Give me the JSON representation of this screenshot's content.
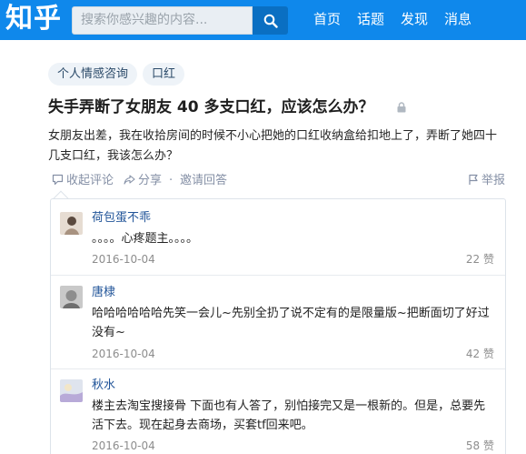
{
  "header": {
    "logo": "知乎",
    "search_placeholder": "搜索你感兴趣的内容...",
    "nav": [
      "首页",
      "话题",
      "发现",
      "消息"
    ],
    "brand_color": "#0f88eb"
  },
  "question": {
    "tags": [
      "个人情感咨询",
      "口红"
    ],
    "title": "失手弄断了女朋友 40 多支口红，应该怎么办？",
    "detail": "女朋友出差，我在收拾房间的时候不小心把她的口红收纳盒给扣地上了，弄断了她四十几支口红，我该怎么办？",
    "actions": {
      "collapse_comments": "收起评论",
      "share": "分享",
      "separator": "·",
      "invite": "邀请回答",
      "report": "举报"
    }
  },
  "comments": [
    {
      "author": "荷包蛋不乖",
      "text": "。。。。心疼题主。。。。",
      "date": "2016-10-04",
      "likes": "22 赞"
    },
    {
      "author": "唐棣",
      "text": "哈哈哈哈哈哈先笑一会儿~先别全扔了说不定有的是限量版~把断面切了好过没有~",
      "date": "2016-10-04",
      "likes": "42 赞"
    },
    {
      "author": "秋水",
      "text": "楼主去淘宝搜接骨 下面也有人答了，别怕接完又是一根新的。但是，总要先活下去。现在起身去商场，买套tf回来吧。",
      "date": "2016-10-04",
      "likes": "58 赞"
    }
  ]
}
